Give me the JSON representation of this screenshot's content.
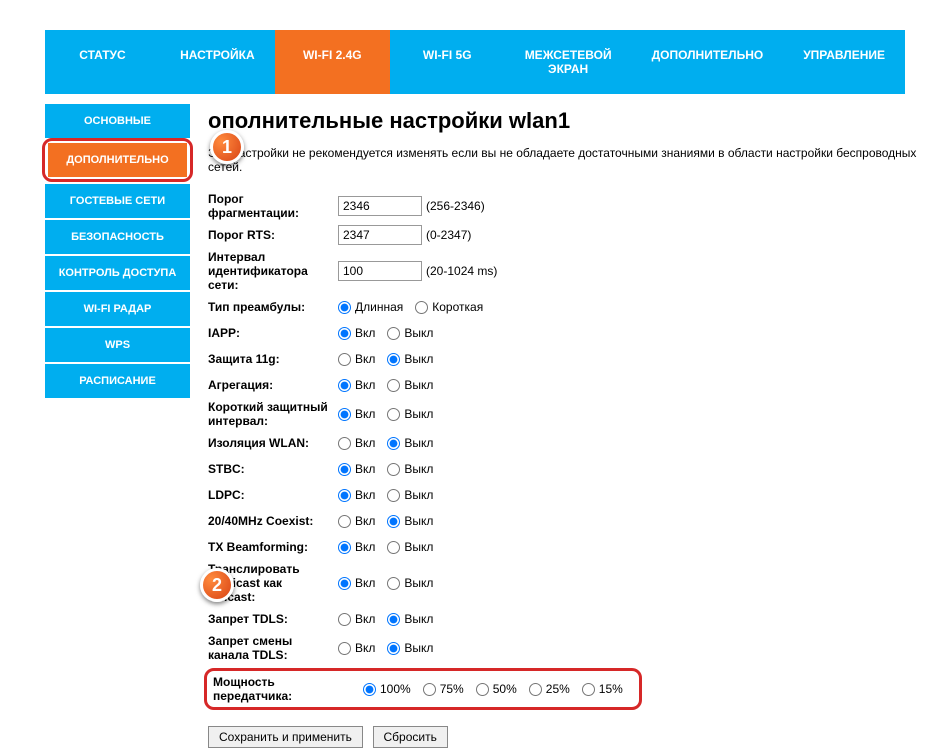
{
  "topnav": [
    {
      "label": "СТАТУС"
    },
    {
      "label": "НАСТРОЙКА"
    },
    {
      "label": "WI-FI 2.4G",
      "active": true
    },
    {
      "label": "WI-FI 5G"
    },
    {
      "label": "МЕЖСЕТЕВОЙ ЭКРАН"
    },
    {
      "label": "ДОПОЛНИТЕЛЬНО"
    },
    {
      "label": "УПРАВЛЕНИЕ"
    }
  ],
  "sidebar": [
    {
      "label": "ОСНОВНЫЕ"
    },
    {
      "label": "ДОПОЛНИТЕЛЬНО",
      "active": true
    },
    {
      "label": "ГОСТЕВЫЕ СЕТИ"
    },
    {
      "label": "БЕЗОПАСНОСТЬ"
    },
    {
      "label": "КОНТРОЛЬ ДОСТУПА"
    },
    {
      "label": "WI-FI РАДАР"
    },
    {
      "label": "WPS"
    },
    {
      "label": "РАСПИСАНИЕ"
    }
  ],
  "page": {
    "title": "ополнительные настройки wlan1",
    "desc": "Эти настройки не рекомендуется изменять если вы не обладаете достаточными знаниями в области настройки беспроводных сетей."
  },
  "fields": {
    "frag": {
      "label": "Порог фрагментации:",
      "value": "2346",
      "hint": "(256-2346)"
    },
    "rts": {
      "label": "Порог RTS:",
      "value": "2347",
      "hint": "(0-2347)"
    },
    "beacon": {
      "label": "Интервал идентификатора сети:",
      "value": "100",
      "hint": "(20-1024 ms)"
    },
    "preamble": {
      "label": "Тип преамбулы:",
      "opts": [
        "Длинная",
        "Короткая"
      ],
      "sel": 0
    },
    "iapp": {
      "label": "IAPP:",
      "opts": [
        "Вкл",
        "Выкл"
      ],
      "sel": 0
    },
    "prot11g": {
      "label": "Защита 11g:",
      "opts": [
        "Вкл",
        "Выкл"
      ],
      "sel": 1
    },
    "aggr": {
      "label": "Агрегация:",
      "opts": [
        "Вкл",
        "Выкл"
      ],
      "sel": 0
    },
    "shortgi": {
      "label": "Короткий защитный интервал:",
      "opts": [
        "Вкл",
        "Выкл"
      ],
      "sel": 0
    },
    "isolation": {
      "label": "Изоляция WLAN:",
      "opts": [
        "Вкл",
        "Выкл"
      ],
      "sel": 1
    },
    "stbc": {
      "label": "STBC:",
      "opts": [
        "Вкл",
        "Выкл"
      ],
      "sel": 0
    },
    "ldpc": {
      "label": "LDPC:",
      "opts": [
        "Вкл",
        "Выкл"
      ],
      "sel": 0
    },
    "coex": {
      "label": "20/40MHz Coexist:",
      "opts": [
        "Вкл",
        "Выкл"
      ],
      "sel": 1
    },
    "txbf": {
      "label": "TX Beamforming:",
      "opts": [
        "Вкл",
        "Выкл"
      ],
      "sel": 0
    },
    "mc2uc": {
      "label": "Транслировать Multicast как Unicast:",
      "opts": [
        "Вкл",
        "Выкл"
      ],
      "sel": 0
    },
    "tdls": {
      "label": "Запрет TDLS:",
      "opts": [
        "Вкл",
        "Выкл"
      ],
      "sel": 1
    },
    "tdls_ch": {
      "label": "Запрет смены канала TDLS:",
      "opts": [
        "Вкл",
        "Выкл"
      ],
      "sel": 1
    },
    "power": {
      "label": "Мощность передатчика:",
      "opts": [
        "100%",
        "75%",
        "50%",
        "25%",
        "15%"
      ],
      "sel": 0
    }
  },
  "buttons": {
    "save": "Сохранить и применить",
    "reset": "Сбросить"
  },
  "badges": {
    "b1": "1",
    "b2": "2"
  }
}
